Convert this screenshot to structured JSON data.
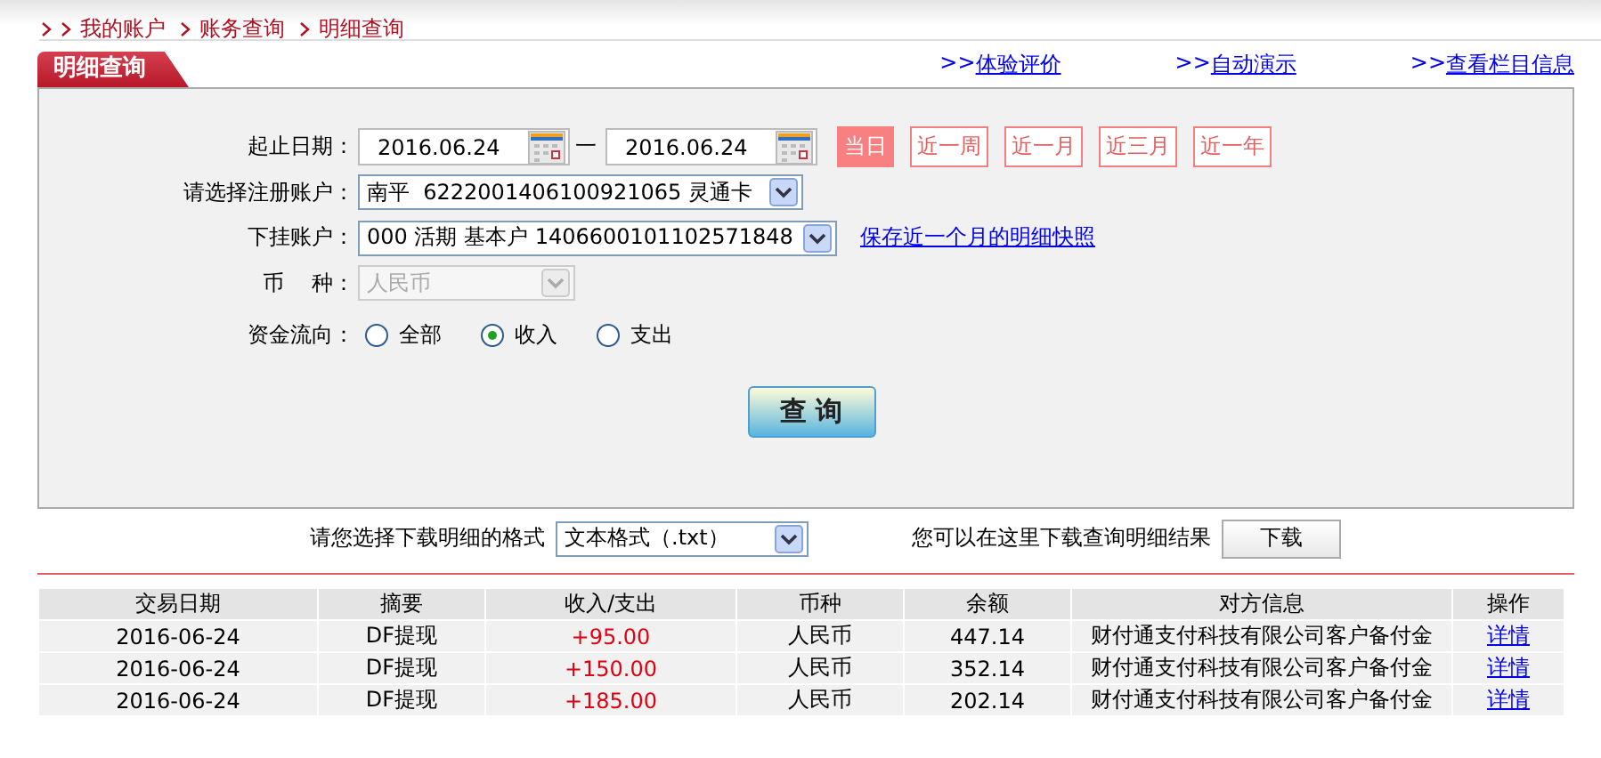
{
  "breadcrumb": [
    "我的账户",
    "账务查询",
    "明细查询"
  ],
  "tab": {
    "title": "明细查询"
  },
  "links": [
    {
      "prefix": ">>",
      "label": "体验评价"
    },
    {
      "prefix": ">>",
      "label": "自动演示"
    },
    {
      "prefix": ">>",
      "label": "查看栏目信息"
    }
  ],
  "form": {
    "date_label": "起止日期：",
    "date_from": "2016.06.24",
    "date_sep": "一",
    "date_to": "2016.06.24",
    "ranges": [
      {
        "label": "当日",
        "selected": true
      },
      {
        "label": "近一周",
        "selected": false
      },
      {
        "label": "近一月",
        "selected": false
      },
      {
        "label": "近三月",
        "selected": false
      },
      {
        "label": "近一年",
        "selected": false
      }
    ],
    "account_label": "请选择注册账户：",
    "account": "南平  6222001406100921065 灵通卡",
    "sub_label": "下挂账户：",
    "sub_account": "000 活期 基本户 1406600101102571848",
    "snapshot_link": "保存近一个月的明细快照",
    "currency_label": "币    种：",
    "currency": "人民币",
    "currency_disabled": true,
    "flow_label": "资金流向：",
    "flow": [
      {
        "label": "全部",
        "selected": false
      },
      {
        "label": "收入",
        "selected": true
      },
      {
        "label": "支出",
        "selected": false
      }
    ],
    "submit": "查 询"
  },
  "download": {
    "label": "请您选择下载明细的格式",
    "format": "文本格式（.txt）",
    "hint": "您可以在这里下载查询明细结果",
    "button": "下载"
  },
  "table": {
    "columns": [
      "交易日期",
      "摘要",
      "收入/支出",
      "币种",
      "余额",
      "对方信息",
      "操作"
    ],
    "rows": [
      {
        "date": "2016-06-24",
        "summary": "DF提现",
        "amount": "+95.00",
        "kind": "income",
        "currency": "人民币",
        "balance": "447.14",
        "counterparty": "财付通支付科技有限公司客户备付金",
        "action": "详情"
      },
      {
        "date": "2016-06-24",
        "summary": "DF提现",
        "amount": "+150.00",
        "kind": "income",
        "currency": "人民币",
        "balance": "352.14",
        "counterparty": "财付通支付科技有限公司客户备付金",
        "action": "详情"
      },
      {
        "date": "2016-06-24",
        "summary": "DF提现",
        "amount": "+185.00",
        "kind": "income",
        "currency": "人民币",
        "balance": "202.14",
        "counterparty": "财付通支付科技有限公司客户备付金",
        "action": "详情"
      }
    ]
  }
}
